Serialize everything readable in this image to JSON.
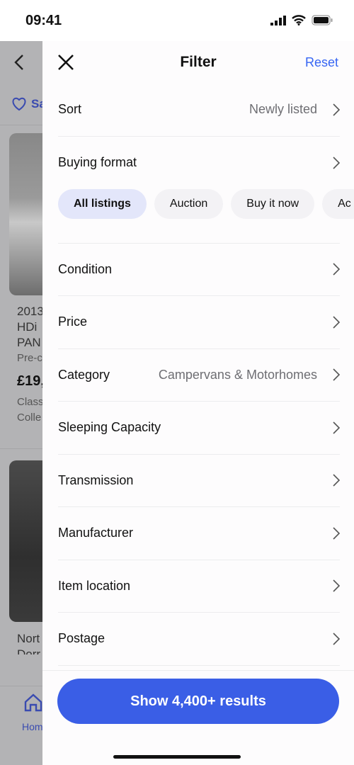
{
  "status": {
    "time": "09:41"
  },
  "background": {
    "saved_label": "Sa",
    "listing1": [
      "2013",
      "HDi",
      "PAN",
      "Pre-c",
      "£19,",
      "Class",
      "Colle"
    ],
    "listing2": [
      "Nort",
      "Dorr"
    ],
    "nav_home": "Hom"
  },
  "filter": {
    "title": "Filter",
    "reset": "Reset",
    "sort": {
      "label": "Sort",
      "value": "Newly listed"
    },
    "buying_format": {
      "label": "Buying format",
      "chips": [
        "All listings",
        "Auction",
        "Buy it now",
        "Ac"
      ],
      "selected": "All listings"
    },
    "rows": [
      {
        "label": "Condition",
        "value": ""
      },
      {
        "label": "Price",
        "value": ""
      },
      {
        "label": "Category",
        "value": "Campervans & Motorhomes"
      },
      {
        "label": "Sleeping Capacity",
        "value": ""
      },
      {
        "label": "Transmission",
        "value": ""
      },
      {
        "label": "Manufacturer",
        "value": ""
      },
      {
        "label": "Item location",
        "value": ""
      },
      {
        "label": "Postage",
        "value": ""
      }
    ],
    "show_button": "Show 4,400+ results"
  },
  "colors": {
    "accent": "#3665f3",
    "button": "#3a5ee6",
    "chip_selected": "#e3e6fa"
  }
}
